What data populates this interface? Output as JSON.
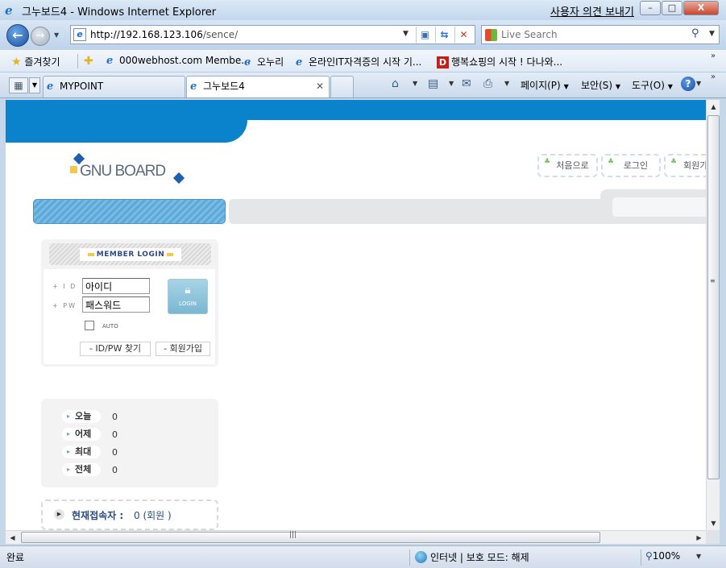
{
  "window": {
    "title": "그누보드4 - Windows Internet Explorer",
    "feedback_link": "사용자 의견 보내기",
    "minimize": "–",
    "maximize": "□",
    "close": "X"
  },
  "nav": {
    "back_glyph": "←",
    "forward_glyph": "→",
    "url_host": "http://192.168.123.106",
    "url_path": "/sence/",
    "search_placeholder": "Live Search"
  },
  "favorites": {
    "label": "즐겨찾기",
    "items": [
      {
        "label": "000webhost.com Membe..."
      },
      {
        "label": "오누리"
      },
      {
        "label": "온라인IT자격증의 시작 기..."
      },
      {
        "label": "행복쇼핑의 시작 ! 다나와..."
      }
    ]
  },
  "tabs": [
    {
      "label": "MYPOINT"
    },
    {
      "label": "그누보드4"
    }
  ],
  "commands": {
    "page": "페이지(P)",
    "safety": "보안(S)",
    "tools": "도구(O)",
    "help": "?"
  },
  "site": {
    "logo_text": "GNU BOARD",
    "top_links": [
      {
        "label": "처음으로"
      },
      {
        "label": "로그인"
      },
      {
        "label": "회원가"
      }
    ],
    "login": {
      "header": "MEMBER LOGIN",
      "id_label": "+ I D",
      "pw_label": "+ PW",
      "id_value": "아이디",
      "pw_value": "패스워드",
      "login_button": "LOGIN",
      "auto_label": "AUTO",
      "find_button": "- ID/PW 찾기",
      "join_button": "- 회원가입"
    },
    "stats": [
      {
        "label": "오늘",
        "value": "0"
      },
      {
        "label": "어제",
        "value": "0"
      },
      {
        "label": "최대",
        "value": "0"
      },
      {
        "label": "전체",
        "value": "0"
      }
    ],
    "connected": {
      "label": "현재접속자 :",
      "value": "0 (회원 )"
    }
  },
  "status": {
    "text": "완료",
    "zone": "인터넷 | 보호 모드: 해제",
    "zoom": "100%"
  }
}
